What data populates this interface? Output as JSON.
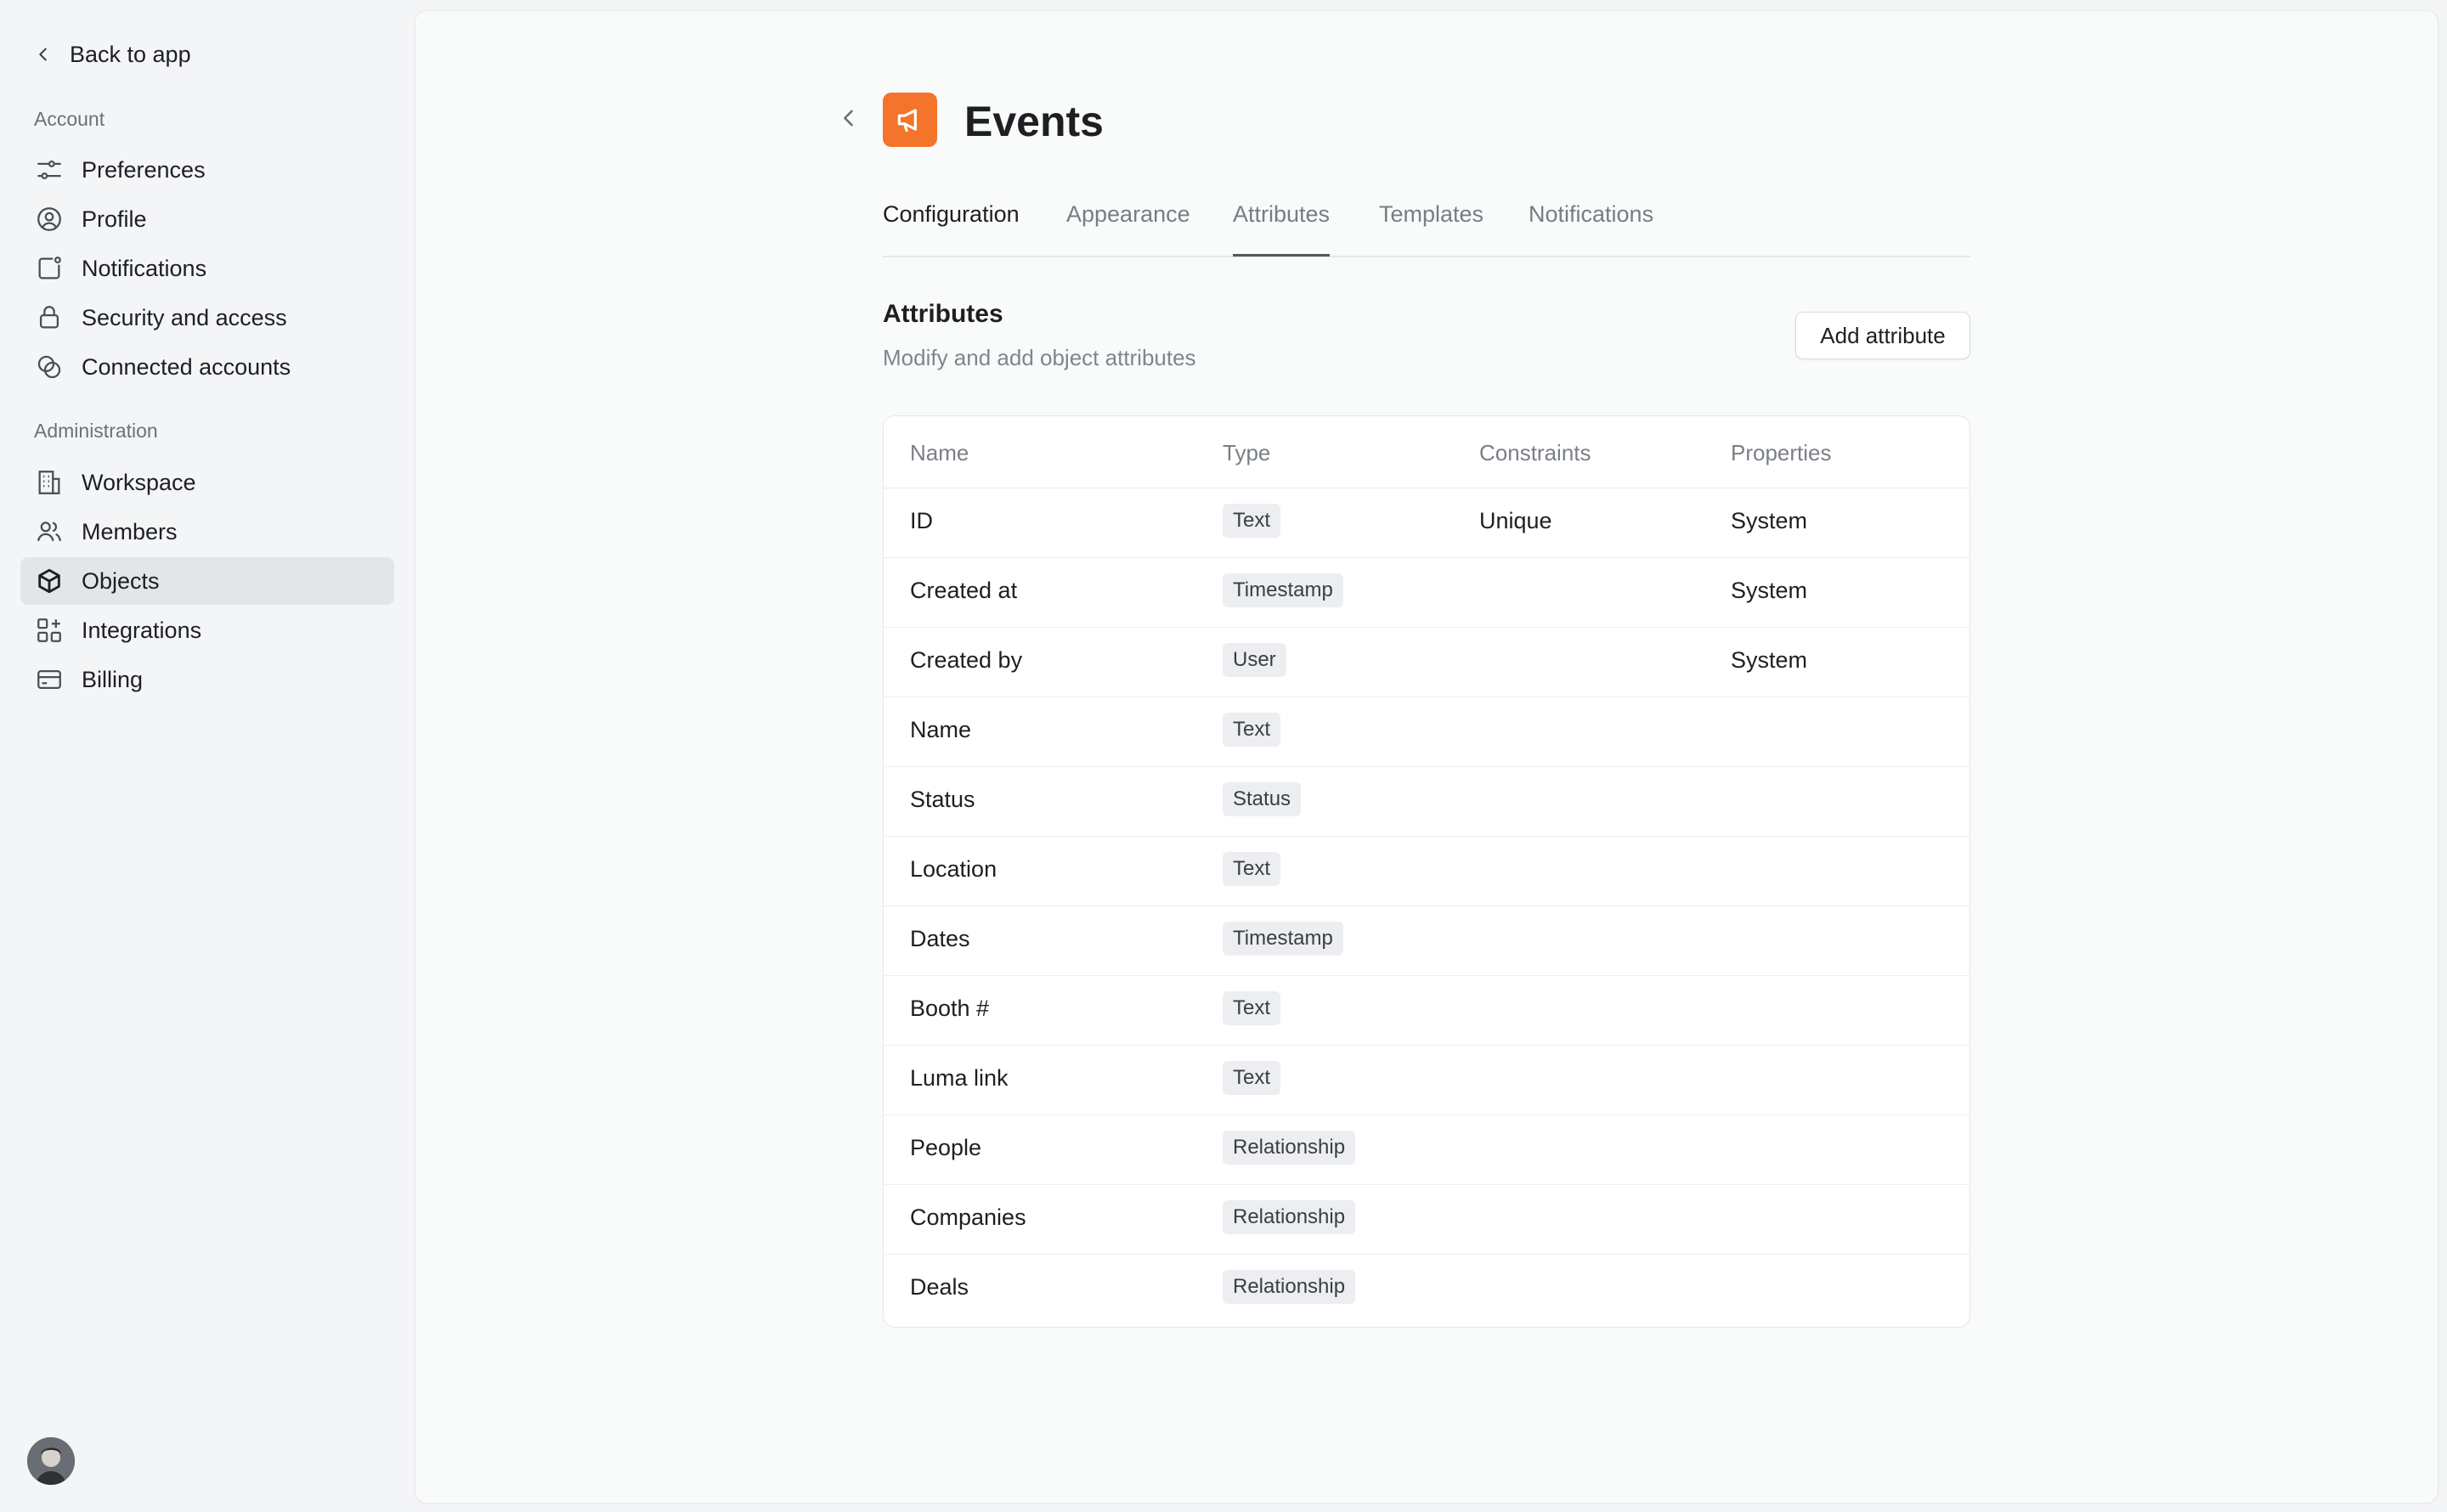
{
  "sidebar": {
    "back_label": "Back to app",
    "account_label": "Account",
    "account_items": [
      {
        "label": "Preferences",
        "icon": "sliders-icon"
      },
      {
        "label": "Profile",
        "icon": "user-circle-icon"
      },
      {
        "label": "Notifications",
        "icon": "bell-square-icon"
      },
      {
        "label": "Security and access",
        "icon": "lock-icon"
      },
      {
        "label": "Connected accounts",
        "icon": "link-icon"
      }
    ],
    "admin_label": "Administration",
    "admin_items": [
      {
        "label": "Workspace",
        "icon": "building-icon"
      },
      {
        "label": "Members",
        "icon": "users-icon"
      },
      {
        "label": "Objects",
        "icon": "cube-icon",
        "active": true
      },
      {
        "label": "Integrations",
        "icon": "grid-plus-icon"
      },
      {
        "label": "Billing",
        "icon": "card-icon"
      }
    ]
  },
  "header": {
    "title": "Events",
    "icon": "megaphone-icon",
    "icon_color": "#f3742a"
  },
  "tabs": [
    {
      "label": "Configuration"
    },
    {
      "label": "Appearance"
    },
    {
      "label": "Attributes",
      "selected": true
    },
    {
      "label": "Templates"
    },
    {
      "label": "Notifications"
    }
  ],
  "section": {
    "title": "Attributes",
    "subtitle": "Modify and add object attributes",
    "add_button": "Add attribute"
  },
  "table": {
    "columns": [
      "Name",
      "Type",
      "Constraints",
      "Properties"
    ],
    "rows": [
      {
        "name": "ID",
        "type": "Text",
        "constraints": "Unique",
        "properties": "System"
      },
      {
        "name": "Created at",
        "type": "Timestamp",
        "constraints": "",
        "properties": "System"
      },
      {
        "name": "Created by",
        "type": "User",
        "constraints": "",
        "properties": "System"
      },
      {
        "name": "Name",
        "type": "Text",
        "constraints": "",
        "properties": ""
      },
      {
        "name": "Status",
        "type": "Status",
        "constraints": "",
        "properties": ""
      },
      {
        "name": "Location",
        "type": "Text",
        "constraints": "",
        "properties": ""
      },
      {
        "name": "Dates",
        "type": "Timestamp",
        "constraints": "",
        "properties": ""
      },
      {
        "name": "Booth #",
        "type": "Text",
        "constraints": "",
        "properties": ""
      },
      {
        "name": "Luma link",
        "type": "Text",
        "constraints": "",
        "properties": ""
      },
      {
        "name": "People",
        "type": "Relationship",
        "constraints": "",
        "properties": ""
      },
      {
        "name": "Companies",
        "type": "Relationship",
        "constraints": "",
        "properties": ""
      },
      {
        "name": "Deals",
        "type": "Relationship",
        "constraints": "",
        "properties": ""
      }
    ]
  }
}
